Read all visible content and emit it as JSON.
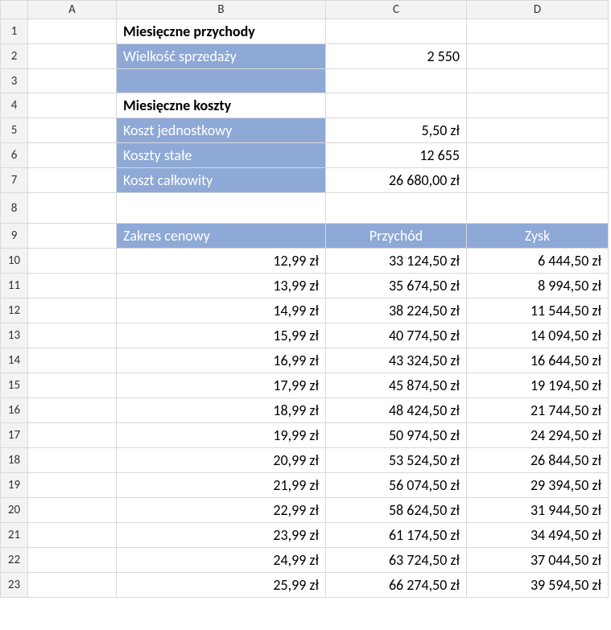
{
  "columns": {
    "A": "A",
    "B": "B",
    "C": "C",
    "D": "D"
  },
  "rows": {
    "r1": "1",
    "r2": "2",
    "r3": "3",
    "r4": "4",
    "r5": "5",
    "r6": "6",
    "r7": "7",
    "r8": "8",
    "r9": "9",
    "r10": "10",
    "r11": "11",
    "r12": "12",
    "r13": "13",
    "r14": "14",
    "r15": "15",
    "r16": "16",
    "r17": "17",
    "r18": "18",
    "r19": "19",
    "r20": "20",
    "r21": "21",
    "r22": "22",
    "r23": "23"
  },
  "header1": "Miesięczne przychody",
  "sales_label": "Wielkość sprzedaży",
  "sales_value": "2 550",
  "header2": "Miesięczne koszty",
  "unit_cost_label": "Koszt jednostkowy",
  "unit_cost_value": "5,50 zł",
  "fixed_cost_label": "Koszty stałe",
  "fixed_cost_value": "12 655",
  "total_cost_label": "Koszt całkowity",
  "total_cost_value": "26 680,00 zł",
  "table_header": {
    "b": "Zakres cenowy",
    "c": "Przychód",
    "d": "Zysk"
  },
  "data": [
    {
      "b": "12,99 zł",
      "c": "33 124,50 zł",
      "d": "6 444,50 zł"
    },
    {
      "b": "13,99 zł",
      "c": "35 674,50 zł",
      "d": "8 994,50 zł"
    },
    {
      "b": "14,99 zł",
      "c": "38 224,50 zł",
      "d": "11 544,50 zł"
    },
    {
      "b": "15,99 zł",
      "c": "40 774,50 zł",
      "d": "14 094,50 zł"
    },
    {
      "b": "16,99 zł",
      "c": "43 324,50 zł",
      "d": "16 644,50 zł"
    },
    {
      "b": "17,99 zł",
      "c": "45 874,50 zł",
      "d": "19 194,50 zł"
    },
    {
      "b": "18,99 zł",
      "c": "48 424,50 zł",
      "d": "21 744,50 zł"
    },
    {
      "b": "19,99 zł",
      "c": "50 974,50 zł",
      "d": "24 294,50 zł"
    },
    {
      "b": "20,99 zł",
      "c": "53 524,50 zł",
      "d": "26 844,50 zł"
    },
    {
      "b": "21,99 zł",
      "c": "56 074,50 zł",
      "d": "29 394,50 zł"
    },
    {
      "b": "22,99 zł",
      "c": "58 624,50 zł",
      "d": "31 944,50 zł"
    },
    {
      "b": "23,99 zł",
      "c": "61 174,50 zł",
      "d": "34 494,50 zł"
    },
    {
      "b": "24,99 zł",
      "c": "63 724,50 zł",
      "d": "37 044,50 zł"
    },
    {
      "b": "25,99 zł",
      "c": "66 274,50 zł",
      "d": "39 594,50 zł"
    }
  ]
}
